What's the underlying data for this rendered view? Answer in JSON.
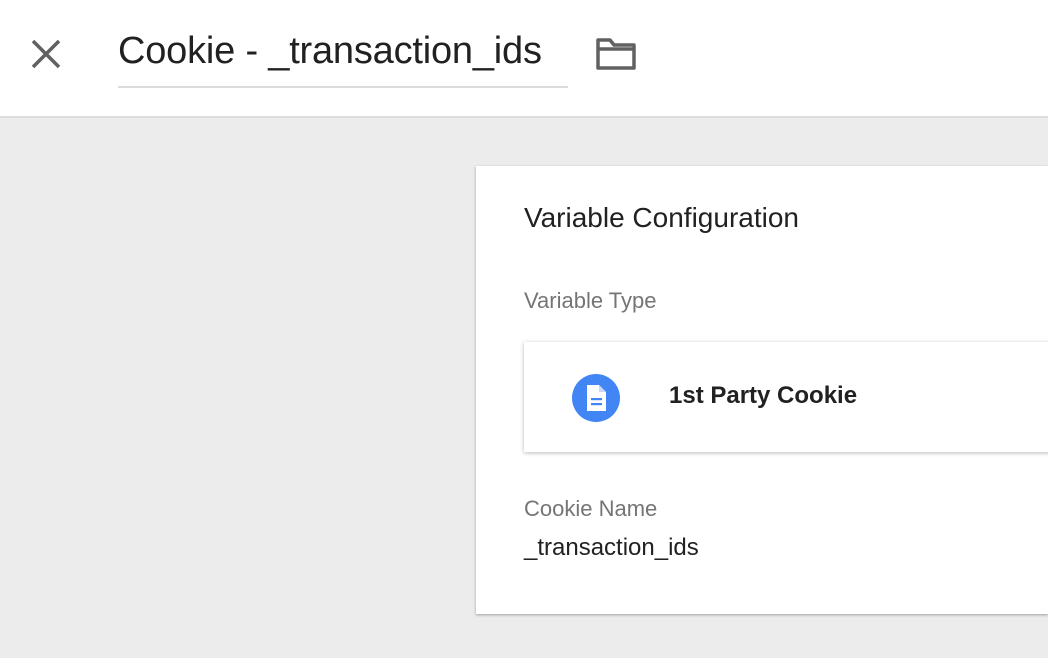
{
  "header": {
    "title": "Cookie - _transaction_ids",
    "close_icon": "close-icon",
    "folder_icon": "folder-icon"
  },
  "config": {
    "heading": "Variable Configuration",
    "variable_type_label": "Variable Type",
    "variable_type": {
      "name": "1st Party Cookie",
      "icon": "document-icon",
      "icon_color": "#4285f4"
    },
    "cookie_name_label": "Cookie Name",
    "cookie_name_value": "_transaction_ids"
  }
}
